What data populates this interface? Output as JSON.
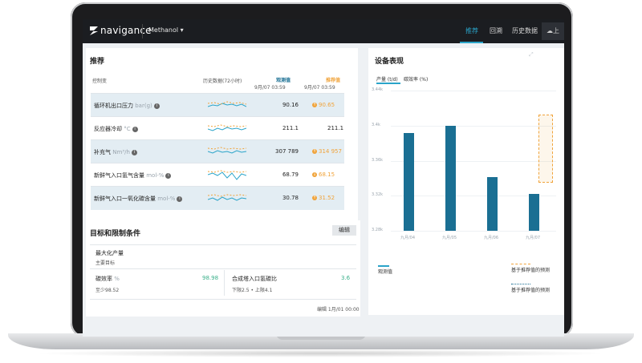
{
  "app": {
    "brand": "navigance",
    "plant": "Methanol",
    "nav": [
      "推荐",
      "回溯",
      "历史数据"
    ],
    "upload_label": "上"
  },
  "recommend": {
    "title": "推荐",
    "col_variable": "控制变",
    "col_history": "历史数据(72小时)",
    "col_observed": "观测值",
    "col_observed_time": "9月/07 03:59",
    "col_recommended": "推荐值",
    "col_recommended_time": "9月/07 03:59",
    "rows": [
      {
        "label": "循环机出口压力",
        "unit": "bar(g)",
        "observed": "90.16",
        "recommended": "90.65"
      },
      {
        "label": "反应器冷却",
        "unit": "°C",
        "observed": "211.1",
        "recommended": "211.1"
      },
      {
        "label": "补充气",
        "unit": "Nm³/h",
        "observed": "307 789",
        "recommended": "314 957"
      },
      {
        "label": "新鲜气入口氢气含量",
        "unit": "mol-%",
        "observed": "68.79",
        "recommended": "68.15"
      },
      {
        "label": "新鲜气入口一氧化碳含量",
        "unit": "mol-%",
        "observed": "30.78",
        "recommended": "31.52"
      }
    ]
  },
  "targets": {
    "title": "目标和限制条件",
    "edit_label": "编辑",
    "objective": "最大化产量",
    "objective_sub": "主要目标",
    "constraints": [
      {
        "label": "碳效率",
        "unit": "%",
        "value": "98.98",
        "limit": "至少98.52"
      },
      {
        "label": "合成塔入口氢碳比",
        "unit": "",
        "value": "3.6",
        "limit": "下限2.5 • 上限4.1"
      }
    ],
    "edited": "编辑 1月/01 00:00"
  },
  "equipment": {
    "title": "设备表现",
    "tabs": [
      "产量 (t/d)",
      "碳效率 (%)"
    ],
    "legend": [
      "观测值",
      "基于推荐值的预测",
      "基于推荐值的预测"
    ],
    "colors": {
      "observed": "#1a6f93",
      "predicted": "#f0a33a",
      "accent": "#2aa4c9"
    }
  },
  "chart_data": {
    "type": "bar",
    "ylabel": "",
    "ylim": [
      3280,
      3440
    ],
    "yticks": [
      "3.44k",
      "3.4k",
      "3.36k",
      "3.32k",
      "3.28k"
    ],
    "categories": [
      "九月/04",
      "九月/05",
      "九月/06",
      "九月/07"
    ],
    "series": [
      {
        "name": "观测值",
        "values": [
          3392,
          3400,
          3341,
          3322
        ]
      }
    ]
  }
}
